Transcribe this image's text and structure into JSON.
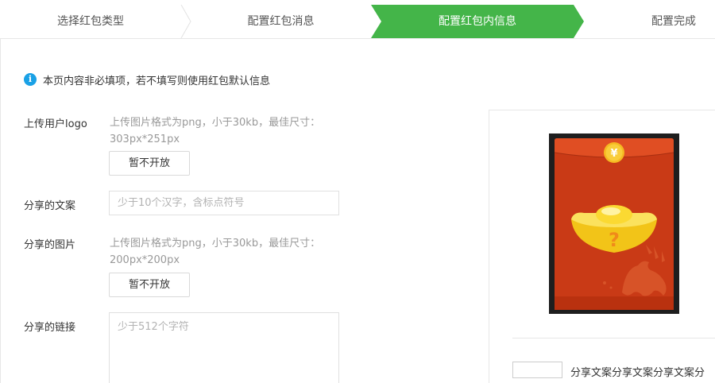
{
  "steps": [
    {
      "label": "选择红包类型",
      "active": false
    },
    {
      "label": "配置红包消息",
      "active": false
    },
    {
      "label": "配置红包内信息",
      "active": true
    },
    {
      "label": "配置完成",
      "active": false
    }
  ],
  "colors": {
    "accent": "#44b549",
    "info": "#1aa1e6",
    "envelope": "#c93a16"
  },
  "notice": {
    "icon": "info-icon",
    "text": "本页内容非必填项，若不填写则使用红包默认信息"
  },
  "form": {
    "logo": {
      "label": "上传用户logo",
      "hint_line1": "上传图片格式为png，小于30kb，最佳尺寸：",
      "hint_line2": "303px*251px",
      "button": "暂不开放"
    },
    "share_text": {
      "label": "分享的文案",
      "placeholder": "少于10个汉字，含标点符号",
      "value": ""
    },
    "share_image": {
      "label": "分享的图片",
      "hint_line1": "上传图片格式为png，小于30kb，最佳尺寸：",
      "hint_line2": "200px*200px",
      "button": "暂不开放"
    },
    "share_link": {
      "label": "分享的链接",
      "placeholder": "少于512个字符",
      "value": ""
    }
  },
  "preview": {
    "envelope_icon": "yen-coin-icon",
    "coin_symbol": "¥",
    "ingot_mark": "?",
    "share_text": "分享文案分享文案分享文案分"
  }
}
